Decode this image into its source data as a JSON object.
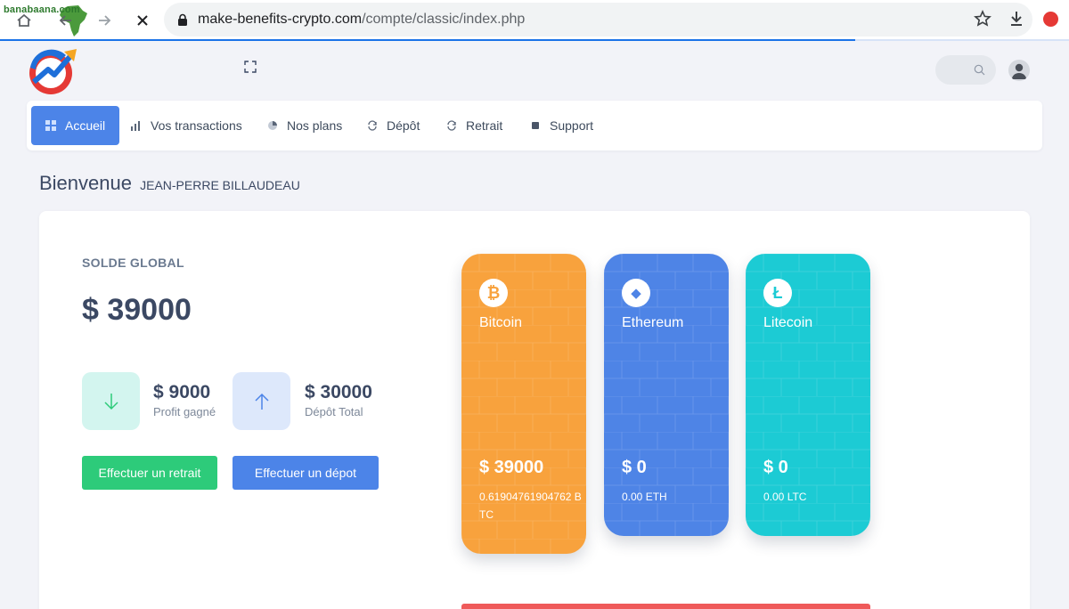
{
  "browser": {
    "watermark": "banabaana.com",
    "url_domain": "make-benefits-crypto.com",
    "url_path": "/compte/classic/index.php",
    "progress_fraction": 0.8
  },
  "nav": {
    "items": [
      {
        "label": "Accueil",
        "icon": "grid-icon",
        "active": true
      },
      {
        "label": "Vos transactions",
        "icon": "bar-chart-icon",
        "active": false
      },
      {
        "label": "Nos plans",
        "icon": "pie-chart-icon",
        "active": false
      },
      {
        "label": "Dépôt",
        "icon": "refresh-icon",
        "active": false
      },
      {
        "label": "Retrait",
        "icon": "refresh-icon",
        "active": false
      },
      {
        "label": "Support",
        "icon": "square-icon",
        "active": false
      }
    ]
  },
  "welcome": {
    "greeting": "Bienvenue",
    "name": "JEAN-PERRE BILLAUDEAU"
  },
  "balance": {
    "label": "SOLDE GLOBAL",
    "value": "$ 39000",
    "profit_value": "$ 9000",
    "profit_caption": "Profit gagné",
    "deposit_value": "$ 30000",
    "deposit_caption": "Dépôt Total",
    "withdraw_button": "Effectuer un retrait",
    "deposit_button": "Effectuer un dépot"
  },
  "wallets": [
    {
      "name": "Bitcoin",
      "symbol": "₿",
      "value": "$ 39000",
      "amount": "0.61904761904762 BTC",
      "color": "#f8a23d"
    },
    {
      "name": "Ethereum",
      "symbol": "◆",
      "value": "$ 0",
      "amount": "0.00 ETH",
      "color": "#4e84e6"
    },
    {
      "name": "Litecoin",
      "symbol": "Ł",
      "value": "$ 0",
      "amount": "0.00 LTC",
      "color": "#1ccbd4"
    }
  ],
  "colors": {
    "primary": "#4c84e8",
    "success": "#2dcb7a",
    "danger": "#ef5a5a"
  }
}
